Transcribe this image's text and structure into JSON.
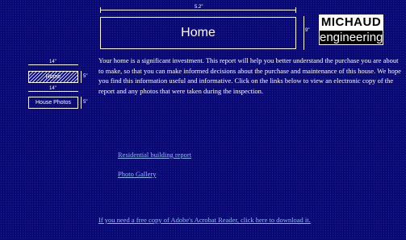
{
  "header": {
    "title": "Home",
    "width_label": "5.2\"",
    "height_label": "9\""
  },
  "logo": {
    "line1": "MICHAUD",
    "line2": "engineering"
  },
  "nav": {
    "home": {
      "label": "Home",
      "width_label": "14\"",
      "height_label": "5\""
    },
    "photos": {
      "label": "House Photos",
      "width_label": "14\"",
      "height_label": "5\""
    }
  },
  "intro": "Your home is a significant investment. This report will help you better understand the purchase you are about to make, so that you can make informed decisions about the purchase and maintenance of this house. We hope you find this information useful and informative.  Click on the links below to view an electronic copy of the report and any photos that were taken during the inspection.",
  "links": {
    "report": "Residential building report",
    "gallery": "Photo Gallery",
    "acrobat": "If you need a free copy of Adobe's Acrobat Reader, click here to download it."
  },
  "colors": {
    "background": "#0a0a78",
    "link": "#8fb7f2",
    "text": "#ffffff"
  }
}
